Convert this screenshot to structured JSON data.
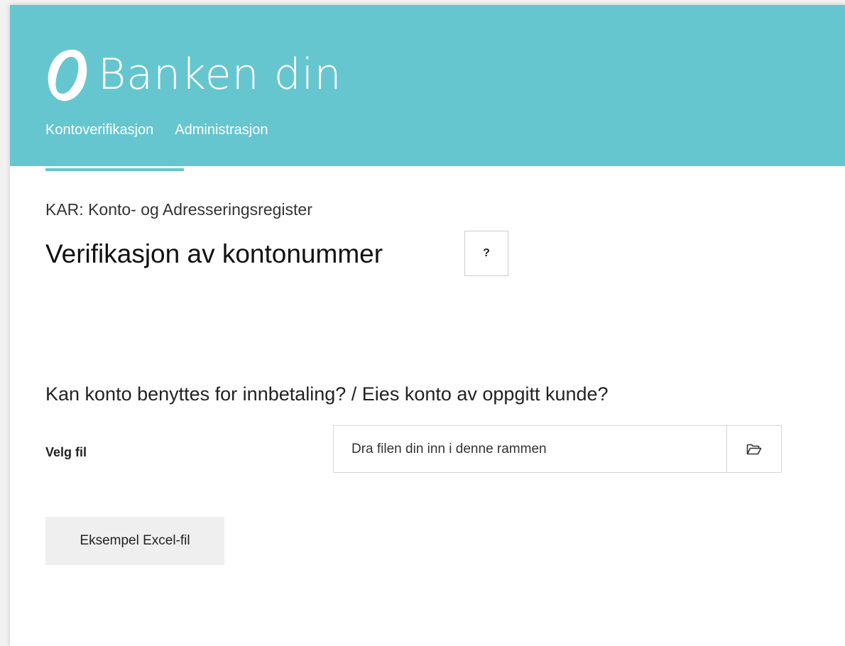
{
  "brand": {
    "name": "Banken din",
    "header_color": "#66c6d0"
  },
  "nav": {
    "items": [
      {
        "label": "Kontoverifikasjon",
        "active": true
      },
      {
        "label": "Administrasjon",
        "active": false
      }
    ]
  },
  "page": {
    "subtitle": "KAR: Konto- og Adresseringsregister",
    "title": "Verifikasjon av kontonummer",
    "help_label": "?",
    "question": "Kan konto benyttes for innbetaling? / Eies konto av oppgitt kunde?"
  },
  "file_upload": {
    "label": "Velg fil",
    "placeholder": "Dra filen din inn i denne rammen",
    "browse_icon": "folder-open-icon"
  },
  "actions": {
    "example_label": "Eksempel Excel-fil"
  }
}
